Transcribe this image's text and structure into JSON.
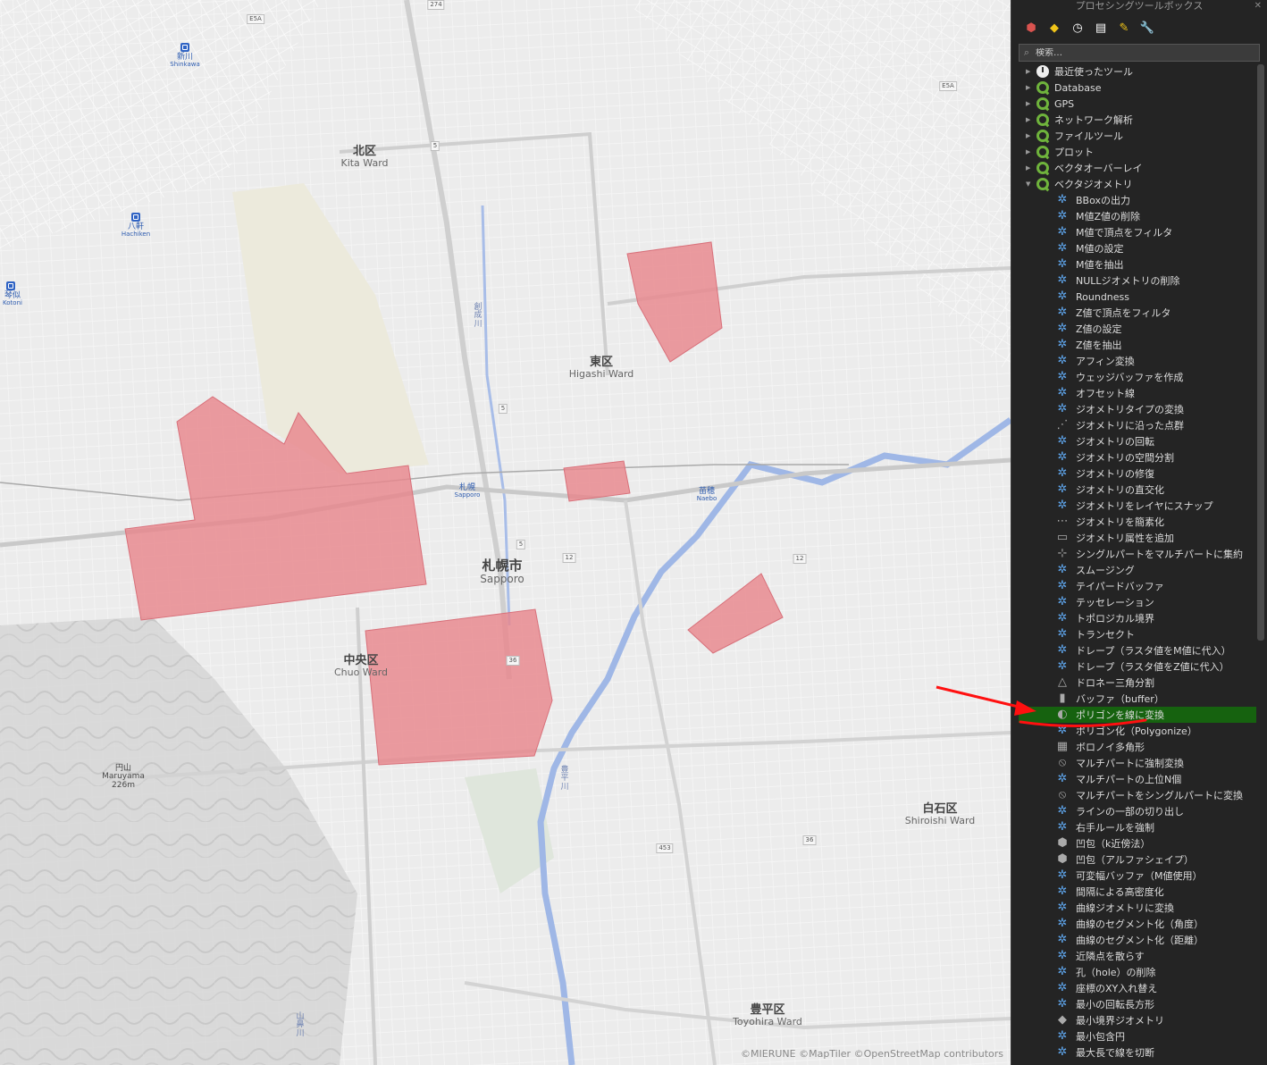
{
  "map": {
    "areas": [
      {
        "jp": "北区",
        "en": "Kita Ward"
      },
      {
        "jp": "東区",
        "en": "Higashi Ward"
      },
      {
        "jp": "札幌市",
        "en": "Sapporo"
      },
      {
        "jp": "中央区",
        "en": "Chuo Ward"
      },
      {
        "jp": "白石区",
        "en": "Shiroishi Ward"
      },
      {
        "jp": "豊平区",
        "en": "Toyohira Ward"
      }
    ],
    "stations": [
      {
        "jp": "新川",
        "en": "Shinkawa"
      },
      {
        "jp": "八軒",
        "en": "Hachiken"
      },
      {
        "jp": "琴似",
        "en": "Kotoni"
      },
      {
        "jp": "札幌",
        "en": "Sapporo"
      },
      {
        "jp": "苗穂",
        "en": "Naebo"
      }
    ],
    "peak": {
      "jp": "円山",
      "en": "Maruyama",
      "elev": "226m"
    },
    "routes": [
      "274",
      "5",
      "5",
      "5",
      "12",
      "12",
      "36",
      "36",
      "453",
      "E5A",
      "E5A"
    ],
    "rivers": [
      "創成川",
      "豊平川",
      "山鼻川"
    ],
    "attribution": "©MIERUNE ©MapTiler ©OpenStreetMap contributors",
    "polygon_color": "#e8868c"
  },
  "panel": {
    "title": "プロセシングツールボックス",
    "close": "✕",
    "search_placeholder": "検索…",
    "toolbar": [
      {
        "name": "models-icon",
        "glyph": "⬢",
        "color": "#d9534f"
      },
      {
        "name": "python-icon",
        "glyph": "◆",
        "color": "#f0c419"
      },
      {
        "name": "history-icon",
        "glyph": "◷",
        "color": "#ffffff"
      },
      {
        "name": "results-icon",
        "glyph": "▤",
        "color": "#ffffff"
      },
      {
        "name": "edit-features-icon",
        "glyph": "✎",
        "color": "#f0c419"
      },
      {
        "name": "options-icon",
        "glyph": "🔧",
        "color": "#ffd36b"
      }
    ],
    "categories": [
      {
        "label": "最近使ったツール",
        "icon": "clock",
        "expanded": false
      },
      {
        "label": "Database",
        "icon": "qgis",
        "expanded": false
      },
      {
        "label": "GPS",
        "icon": "qgis",
        "expanded": false
      },
      {
        "label": "ネットワーク解析",
        "icon": "qgis",
        "expanded": false
      },
      {
        "label": "ファイルツール",
        "icon": "qgis",
        "expanded": false
      },
      {
        "label": "プロット",
        "icon": "qgis",
        "expanded": false
      },
      {
        "label": "ベクタオーバーレイ",
        "icon": "qgis",
        "expanded": false
      },
      {
        "label": "ベクタジオメトリ",
        "icon": "qgis",
        "expanded": true
      }
    ],
    "algorithms": [
      "BBoxの出力",
      "M値Z値の削除",
      "M値で頂点をフィルタ",
      "M値の設定",
      "M値を抽出",
      "NULLジオメトリの削除",
      "Roundness",
      "Z値で頂点をフィルタ",
      "Z値の設定",
      "Z値を抽出",
      "アフィン変換",
      "ウェッジバッファを作成",
      "オフセット線",
      "ジオメトリタイプの変換",
      "ジオメトリに沿った点群",
      "ジオメトリの回転",
      "ジオメトリの空間分割",
      "ジオメトリの修復",
      "ジオメトリの直交化",
      "ジオメトリをレイヤにスナップ",
      "ジオメトリを簡素化",
      "ジオメトリ属性を追加",
      "シングルパートをマルチパートに集約",
      "スムージング",
      "テイパードバッファ",
      "テッセレーション",
      "トポロジカル境界",
      "トランセクト",
      "ドレープ（ラスタ値をM値に代入）",
      "ドレープ（ラスタ値をZ値に代入）",
      "ドロネー三角分割",
      "バッファ（buffer）",
      "ポリゴンを線に変換",
      "ポリゴン化（Polygonize）",
      "ボロノイ多角形",
      "マルチパートに強制変換",
      "マルチパートの上位N個",
      "マルチパートをシングルパートに変換",
      "ラインの一部の切り出し",
      "右手ルールを強制",
      "凹包（k近傍法）",
      "凹包（アルファシェイプ）",
      "可変幅バッファ（M値使用）",
      "間隔による高密度化",
      "曲線ジオメトリに変換",
      "曲線のセグメント化（角度）",
      "曲線のセグメント化（距離）",
      "近隣点を散らす",
      "孔（hole）の削除",
      "座標のXY入れ替え",
      "最小の回転長方形",
      "最小境界ジオメトリ",
      "最小包含円",
      "最大長で線を切断"
    ],
    "selected": "ポリゴンを線に変換",
    "highlight_color": "#16620f",
    "annotation_color": "#ff1010"
  }
}
